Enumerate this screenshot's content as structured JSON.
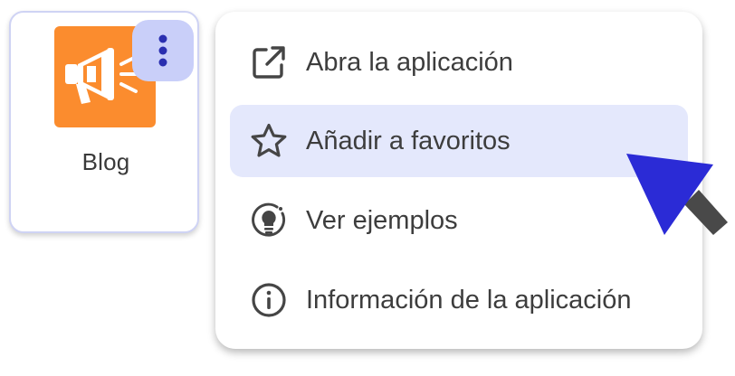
{
  "app_tile": {
    "label": "Blog",
    "icon": "megaphone-icon",
    "icon_bg_color": "#fb8c2e",
    "more_button_icon": "kebab-menu-icon",
    "more_button_bg_color": "#c9cff9"
  },
  "context_menu": {
    "highlight_color": "#e4e8fc",
    "items": [
      {
        "label": "Abra la aplicación",
        "icon": "open-external-icon",
        "highlighted": false
      },
      {
        "label": "Añadir a favoritos",
        "icon": "star-icon",
        "highlighted": true
      },
      {
        "label": "Ver ejemplos",
        "icon": "lightbulb-icon",
        "highlighted": false
      },
      {
        "label": "Información de la aplicación",
        "icon": "info-icon",
        "highlighted": false
      }
    ]
  },
  "cursor": {
    "icon": "arrow-cursor-icon",
    "color": "#2b2bd6"
  }
}
